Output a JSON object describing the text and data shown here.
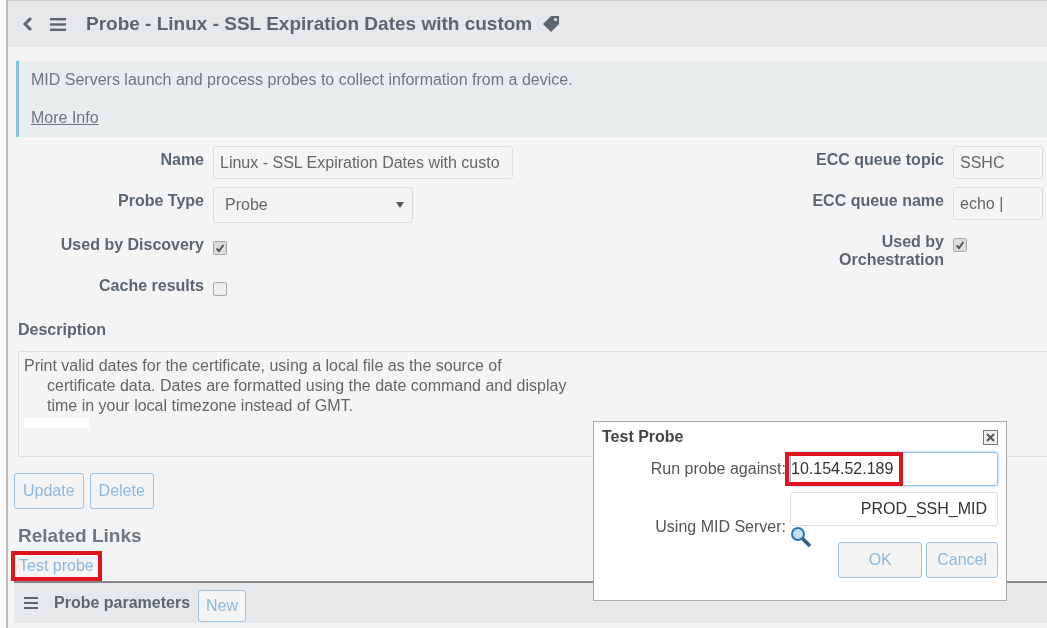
{
  "header": {
    "title": "Probe - Linux - SSL Expiration Dates with custom"
  },
  "info": {
    "message": "MID Servers launch and process probes to collect information from a device.",
    "link": "More Info"
  },
  "left_fields": [
    {
      "kind": "text",
      "label": "Name",
      "value": "Linux - SSL Expiration Dates with custo"
    },
    {
      "kind": "select",
      "label": "Probe Type",
      "value": "Probe"
    },
    {
      "kind": "checkbox",
      "label": "Used by Discovery",
      "checked": true
    },
    {
      "kind": "checkbox",
      "label": "Cache results",
      "checked": false
    }
  ],
  "right_fields": [
    {
      "kind": "text",
      "label": "ECC queue topic",
      "value": "SSHC"
    },
    {
      "kind": "text",
      "label": "ECC queue name",
      "value": "echo |"
    },
    {
      "kind": "checkbox",
      "label": "Used by Orchestration",
      "checked": true
    }
  ],
  "description": {
    "label": "Description",
    "lines": [
      "Print valid dates for the certificate, using a local file as the source of",
      "certificate data. Dates are formatted using the date command and display",
      "time in your local timezone instead of GMT."
    ]
  },
  "buttons": [
    "Update",
    "Delete"
  ],
  "related_links": {
    "title": "Related Links",
    "links": [
      {
        "label": "Test probe",
        "highlighted": true
      }
    ]
  },
  "related_list": {
    "title": "Probe parameters",
    "button": "New"
  },
  "dialog": {
    "title": "Test Probe",
    "fields": [
      {
        "label": "Run probe against:",
        "value": "10.154.52.189",
        "highlighted": true
      },
      {
        "label": "Using MID Server:",
        "value": "PROD_SSH_MID",
        "highlighted": false
      }
    ],
    "buttons": [
      "OK",
      "Cancel"
    ]
  }
}
